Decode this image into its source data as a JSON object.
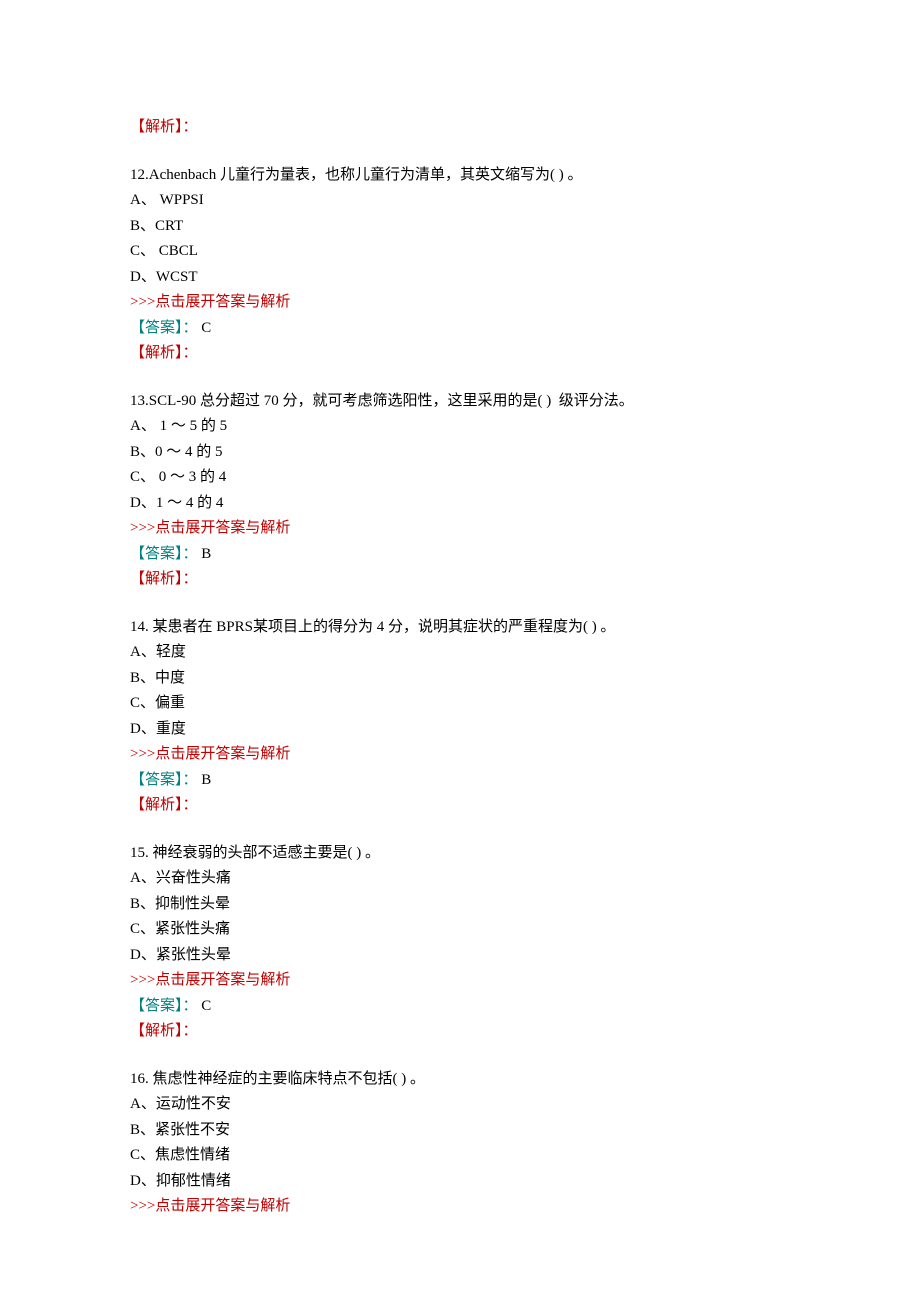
{
  "intro": {
    "analysis_label": "【解析】："
  },
  "questions": [
    {
      "number": "12.",
      "stem_parts": [
        "Achenbach 儿童行为量表，也称儿童行为清单，其英文缩写为( ) 。"
      ],
      "options": [
        "A、 WPPSI",
        "B、CRT",
        "C、 CBCL",
        "D、WCST"
      ],
      "expand": ">>>点击展开答案与解析",
      "answer_label": "【答案】：",
      "answer_value": " C",
      "analysis_label": "【解析】："
    },
    {
      "number": "13.",
      "stem_parts": [
        "SCL-90 总分超过 70 分，就可考虑筛选阳性，这里采用的是( )  级评分法。"
      ],
      "options": [
        "A、 1 ～ 5 的 5",
        "B、0 ～ 4 的 5",
        "C、 0 ～ 3 的 4",
        "D、1 ～ 4 的 4"
      ],
      "expand": ">>>点击展开答案与解析",
      "answer_label": "【答案】：",
      "answer_value": " B",
      "analysis_label": "【解析】："
    },
    {
      "number": "14.",
      "stem_parts": [
        " 某患者在 BPRS某项目上的得分为 4 分，说明其症状的严重程度为( ) 。"
      ],
      "options": [
        "A、轻度",
        "B、中度",
        "C、偏重",
        "D、重度"
      ],
      "expand": ">>>点击展开答案与解析",
      "answer_label": "【答案】：",
      "answer_value": " B",
      "analysis_label": "【解析】："
    },
    {
      "number": "15.",
      "stem_parts": [
        " 神经衰弱的头部不适感主要是( ) 。"
      ],
      "options": [
        "A、兴奋性头痛",
        "B、抑制性头晕",
        "C、紧张性头痛",
        "D、紧张性头晕"
      ],
      "expand": ">>>点击展开答案与解析",
      "answer_label": "【答案】：",
      "answer_value": " C",
      "analysis_label": "【解析】："
    },
    {
      "number": "16.",
      "stem_parts": [
        " 焦虑性神经症的主要临床特点不包括( ) 。"
      ],
      "options": [
        "A、运动性不安",
        "B、紧张性不安",
        "C、焦虑性情绪",
        "D、抑郁性情绪"
      ],
      "expand": ">>>点击展开答案与解析",
      "answer_label": "",
      "answer_value": "",
      "analysis_label": ""
    }
  ]
}
